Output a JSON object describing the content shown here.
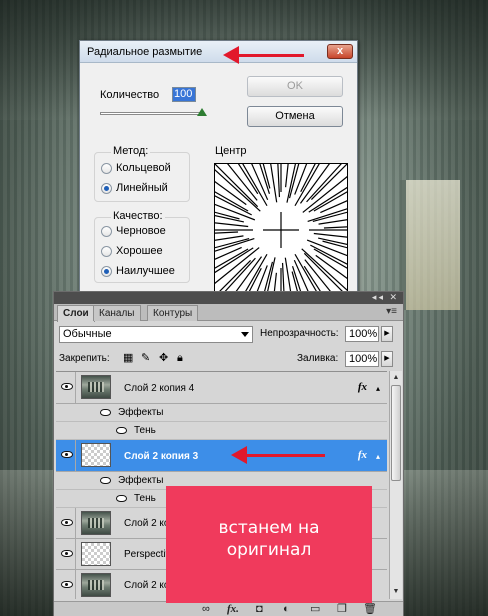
{
  "dialog": {
    "title": "Радиальное размытие",
    "close_label": "x",
    "amount_label": "Количество",
    "amount_value": "100",
    "amount_level_pct": 100,
    "ok_label": "OK",
    "cancel_label": "Отмена",
    "method": {
      "title": "Метод:",
      "options": [
        "Кольцевой",
        "Линейный"
      ],
      "selected": "Линейный"
    },
    "quality": {
      "title": "Качество:",
      "options": [
        "Черновое",
        "Хорошее",
        "Наилучшее"
      ],
      "selected": "Наилучшее"
    },
    "center_label": "Центр"
  },
  "panel": {
    "tabs": [
      "Слои",
      "Каналы",
      "Контуры"
    ],
    "active_tab": "Слои",
    "blend_mode": "Обычные",
    "opacity_label": "Непрозрачность:",
    "opacity_value": "100%",
    "lock_label": "Закрепить:",
    "fill_label": "Заливка:",
    "fill_value": "100%",
    "layers": [
      {
        "name": "Слой 2 копия 4",
        "fx": "fx",
        "selected": false,
        "thumb": "img"
      },
      {
        "name": "Слой 2 копия 3",
        "fx": "fx",
        "selected": true,
        "thumb": "transparent"
      },
      {
        "name": "Слой 2 копия",
        "fx": "",
        "selected": false,
        "thumb": "img"
      },
      {
        "name": "Perspective",
        "fx": "",
        "selected": false,
        "thumb": "transparent"
      },
      {
        "name": "Слой 2 копия",
        "fx": "",
        "selected": false,
        "thumb": "img"
      }
    ],
    "effects_label": "Эффекты",
    "shadow_label": "Тень"
  },
  "callout": {
    "line1": "встанем на",
    "line2": "оригинал"
  },
  "colors": {
    "arrow": "#e2182b",
    "callout_bg": "#f03a5c",
    "selected_layer": "#3d8ee8"
  }
}
